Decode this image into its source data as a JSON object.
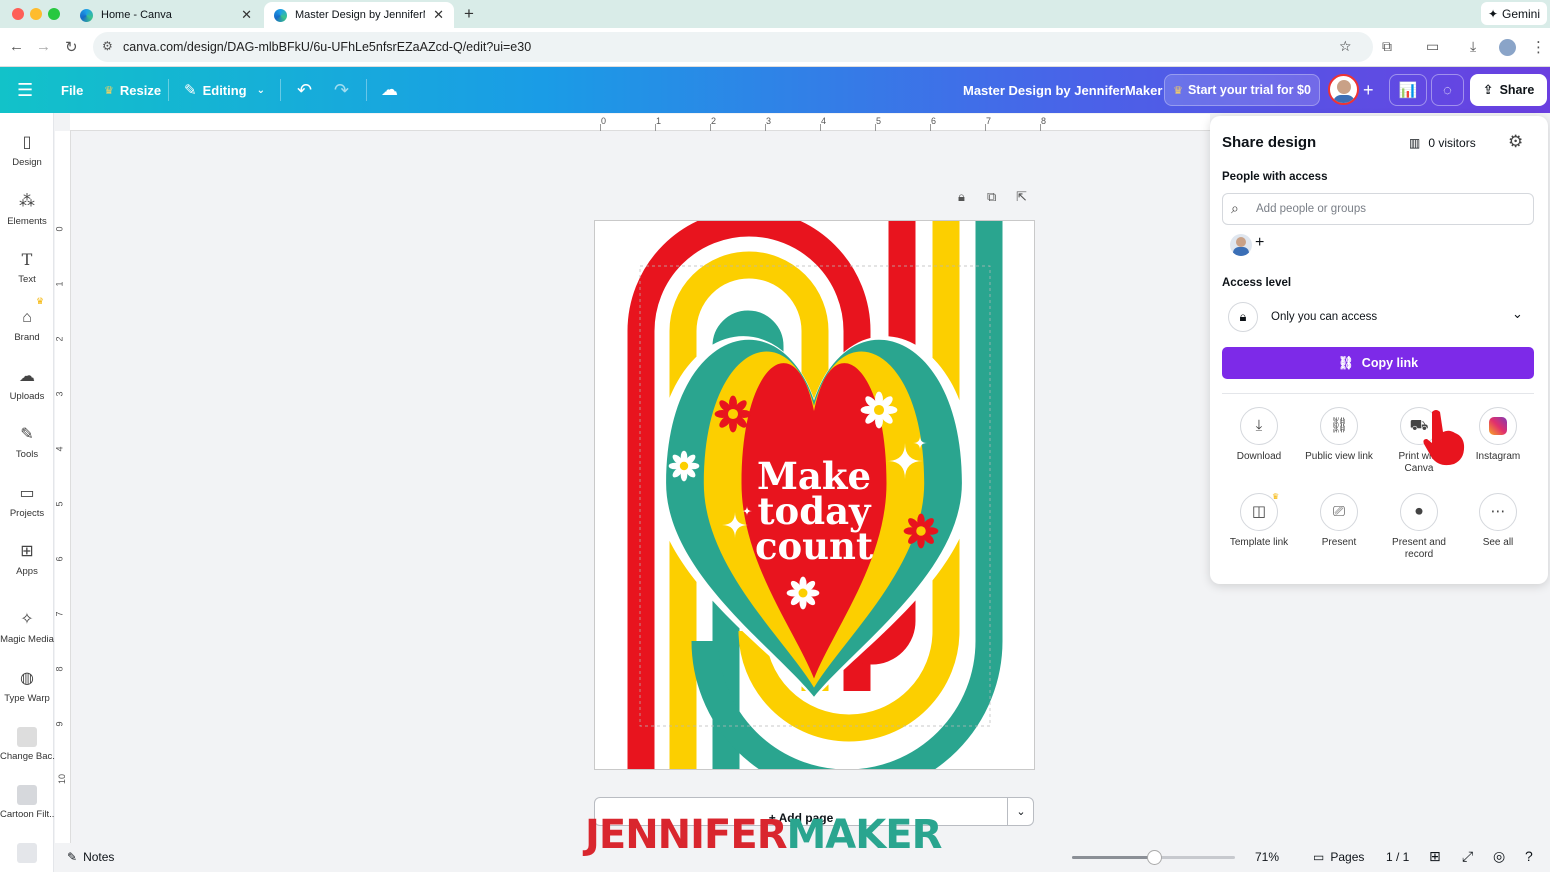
{
  "browser": {
    "tabs": [
      {
        "title": "Home - Canva",
        "active": false
      },
      {
        "title": "Master Design by JenniferMa",
        "active": true
      }
    ],
    "new_tab": "+",
    "url": "canva.com/design/DAG-mlbBFkU/6u-UFhLe5nfsrEZaAZcd-Q/edit?ui=e30",
    "gemini_label": "Gemini"
  },
  "header": {
    "file": "File",
    "resize": "Resize",
    "editing": "Editing",
    "design_title": "Master Design by JenniferMaker",
    "trial": "Start your trial for $0",
    "share": "Share",
    "accent_gradient": [
      "#12c2c9",
      "#6a3fe0"
    ]
  },
  "sidebar": {
    "items": [
      {
        "label": "Design",
        "icon": "design-icon"
      },
      {
        "label": "Elements",
        "icon": "elements-icon"
      },
      {
        "label": "Text",
        "icon": "text-icon"
      },
      {
        "label": "Brand",
        "icon": "brand-icon"
      },
      {
        "label": "Uploads",
        "icon": "uploads-icon"
      },
      {
        "label": "Tools",
        "icon": "tools-icon"
      },
      {
        "label": "Projects",
        "icon": "projects-icon"
      },
      {
        "label": "Apps",
        "icon": "apps-icon"
      },
      {
        "label": "Magic Media",
        "icon": "magic-media-icon"
      },
      {
        "label": "Type Warp",
        "icon": "type-warp-icon"
      },
      {
        "label": "Change Bac...",
        "icon": "change-background-icon"
      },
      {
        "label": "Cartoon Filt...",
        "icon": "cartoon-filter-icon"
      }
    ]
  },
  "ruler": {
    "top": [
      "0",
      "1",
      "2",
      "3",
      "4",
      "5",
      "6",
      "7",
      "8"
    ],
    "left": [
      "0",
      "1",
      "2",
      "3",
      "4",
      "5",
      "6",
      "7",
      "8",
      "9",
      "10"
    ]
  },
  "design": {
    "lines": [
      "Make",
      "today",
      "count"
    ],
    "colors": {
      "red": "#e8141e",
      "yellow": "#fccf00",
      "teal": "#2aa58f",
      "white": "#ffffff"
    }
  },
  "canvas": {
    "add_page": "+ Add page"
  },
  "share_panel": {
    "title": "Share design",
    "visitors": "0 visitors",
    "people_label": "People with access",
    "search_placeholder": "Add people or groups",
    "access_label": "Access level",
    "access_value": "Only you can access",
    "copy_link": "Copy link",
    "copy_color": "#7d2ae8",
    "options": [
      {
        "label": "Download",
        "icon": "download-icon"
      },
      {
        "label": "Public view link",
        "icon": "link-icon"
      },
      {
        "label": "Print with Canva",
        "icon": "print-truck-icon"
      },
      {
        "label": "Instagram",
        "icon": "instagram-icon"
      },
      {
        "label": "Template link",
        "icon": "template-icon"
      },
      {
        "label": "Present",
        "icon": "present-icon"
      },
      {
        "label": "Present and record",
        "icon": "record-icon"
      },
      {
        "label": "See all",
        "icon": "more-icon"
      }
    ]
  },
  "bottom": {
    "notes": "Notes",
    "zoom": "71%",
    "zoom_fraction": 0.5,
    "pages": "Pages",
    "page_count": "1 / 1"
  },
  "watermark": {
    "part1": "JENNIFER",
    "part2": "MAKER",
    "color1": "#d9262e",
    "color2": "#2aa58f"
  }
}
